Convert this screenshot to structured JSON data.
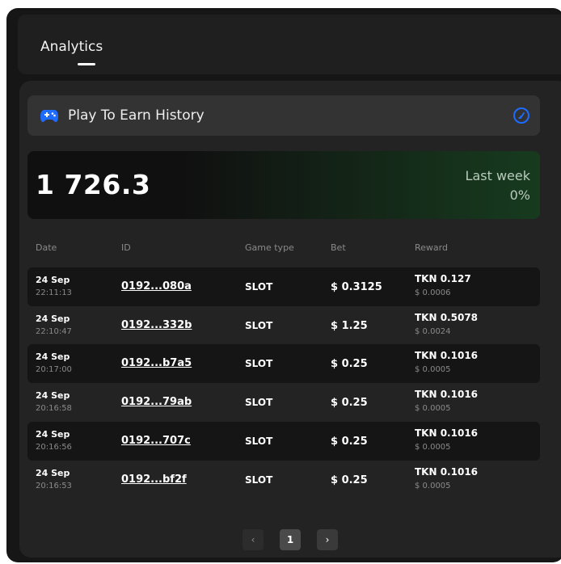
{
  "header": {
    "tab_label": "Analytics"
  },
  "history": {
    "title": "Play To Earn History"
  },
  "stats": {
    "total": "1 726.3",
    "period_label": "Last week",
    "period_change": "0%"
  },
  "table": {
    "columns": [
      "Date",
      "ID",
      "Game type",
      "Bet",
      "Reward"
    ],
    "rows": [
      {
        "date": "24 Sep",
        "time": "22:11:13",
        "id": "0192...080a",
        "game_type": "SLOT",
        "bet": "$ 0.3125",
        "reward_tkn": "TKN 0.127",
        "reward_usd": "$ 0.0006"
      },
      {
        "date": "24 Sep",
        "time": "22:10:47",
        "id": "0192...332b",
        "game_type": "SLOT",
        "bet": "$ 1.25",
        "reward_tkn": "TKN 0.5078",
        "reward_usd": "$ 0.0024"
      },
      {
        "date": "24 Sep",
        "time": "20:17:00",
        "id": "0192...b7a5",
        "game_type": "SLOT",
        "bet": "$ 0.25",
        "reward_tkn": "TKN 0.1016",
        "reward_usd": "$ 0.0005"
      },
      {
        "date": "24 Sep",
        "time": "20:16:58",
        "id": "0192...79ab",
        "game_type": "SLOT",
        "bet": "$ 0.25",
        "reward_tkn": "TKN 0.1016",
        "reward_usd": "$ 0.0005"
      },
      {
        "date": "24 Sep",
        "time": "20:16:56",
        "id": "0192...707c",
        "game_type": "SLOT",
        "bet": "$ 0.25",
        "reward_tkn": "TKN 0.1016",
        "reward_usd": "$ 0.0005"
      },
      {
        "date": "24 Sep",
        "time": "20:16:53",
        "id": "0192...bf2f",
        "game_type": "SLOT",
        "bet": "$ 0.25",
        "reward_tkn": "TKN 0.1016",
        "reward_usd": "$ 0.0005"
      }
    ]
  },
  "pagination": {
    "prev": "‹",
    "current": "1",
    "next": "›"
  },
  "colors": {
    "accent_blue": "#1e6bff",
    "panel_green": "#173b1f"
  },
  "icons": {
    "history": "gamepad-icon",
    "history_action": "compass-icon"
  }
}
